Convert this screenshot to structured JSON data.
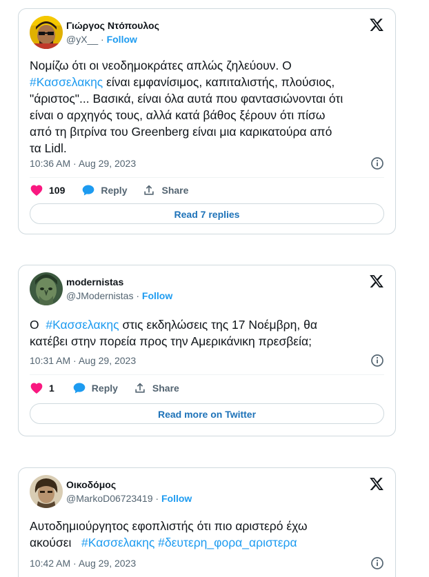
{
  "tweets": [
    {
      "name": "Γιώργος Ντόπουλος",
      "handle": "@yX__",
      "separator": "·",
      "follow": "Follow",
      "text_lines": [
        [
          "Νομίζω ότι οι νεοδημοκράτες απλώς ζηλεύουν. Ο"
        ],
        [
          "#Κασσελακης",
          " είναι εμφανίσιμος, καπιταλιστής, πλούσιος,"
        ],
        [
          "\"άριστος\"... Βασικά, είναι όλα αυτά που φαντασιώνονται ότι"
        ],
        [
          "είναι ο αρχηγός τους, αλλά κατά βάθος ξέρουν ότι πίσω"
        ],
        [
          "από τη βιτρίνα του Greenberg είναι μια καρικατούρα από"
        ],
        [
          "τα Lidl."
        ]
      ],
      "timestamp": "10:36 AM · Aug 29, 2023",
      "likes": "109",
      "reply_label": "Reply",
      "share_label": "Share",
      "footer_button": "Read 7 replies"
    },
    {
      "name": "modernistas",
      "handle": "@JModernistas",
      "separator": "·",
      "follow": "Follow",
      "text_lines": [
        [
          "Ο  ",
          "#Κασσελακης",
          " στις εκδηλώσεις της 17 Νοέμβρη, θα"
        ],
        [
          "κατέβει στην πορεία προς την Αμερικάνικη πρεσβεία;"
        ]
      ],
      "timestamp": "10:31 AM · Aug 29, 2023",
      "likes": "1",
      "reply_label": "Reply",
      "share_label": "Share",
      "footer_button": "Read more on Twitter"
    },
    {
      "name": "Οικοδόμος",
      "handle": "@MarkoD06723419",
      "separator": "·",
      "follow": "Follow",
      "text_lines": [
        [
          "Αυτοδημιούργητος εφοπλιστής ότι πιο αριστερό έχω"
        ],
        [
          "ακούσει   ",
          "#Κασσελακης",
          " ",
          "#δευτερη_φορα_αριστερα"
        ]
      ],
      "timestamp": "10:42 AM · Aug 29, 2023"
    }
  ],
  "colors": {
    "accent": "#1d9bf0",
    "like": "#f91880",
    "secondary_text": "#536471",
    "border": "#cfd9de"
  },
  "icons": {
    "logo": "x-logo-icon",
    "info": "info-icon",
    "like": "heart-icon",
    "reply": "speech-bubble-icon",
    "share": "share-upload-icon"
  }
}
